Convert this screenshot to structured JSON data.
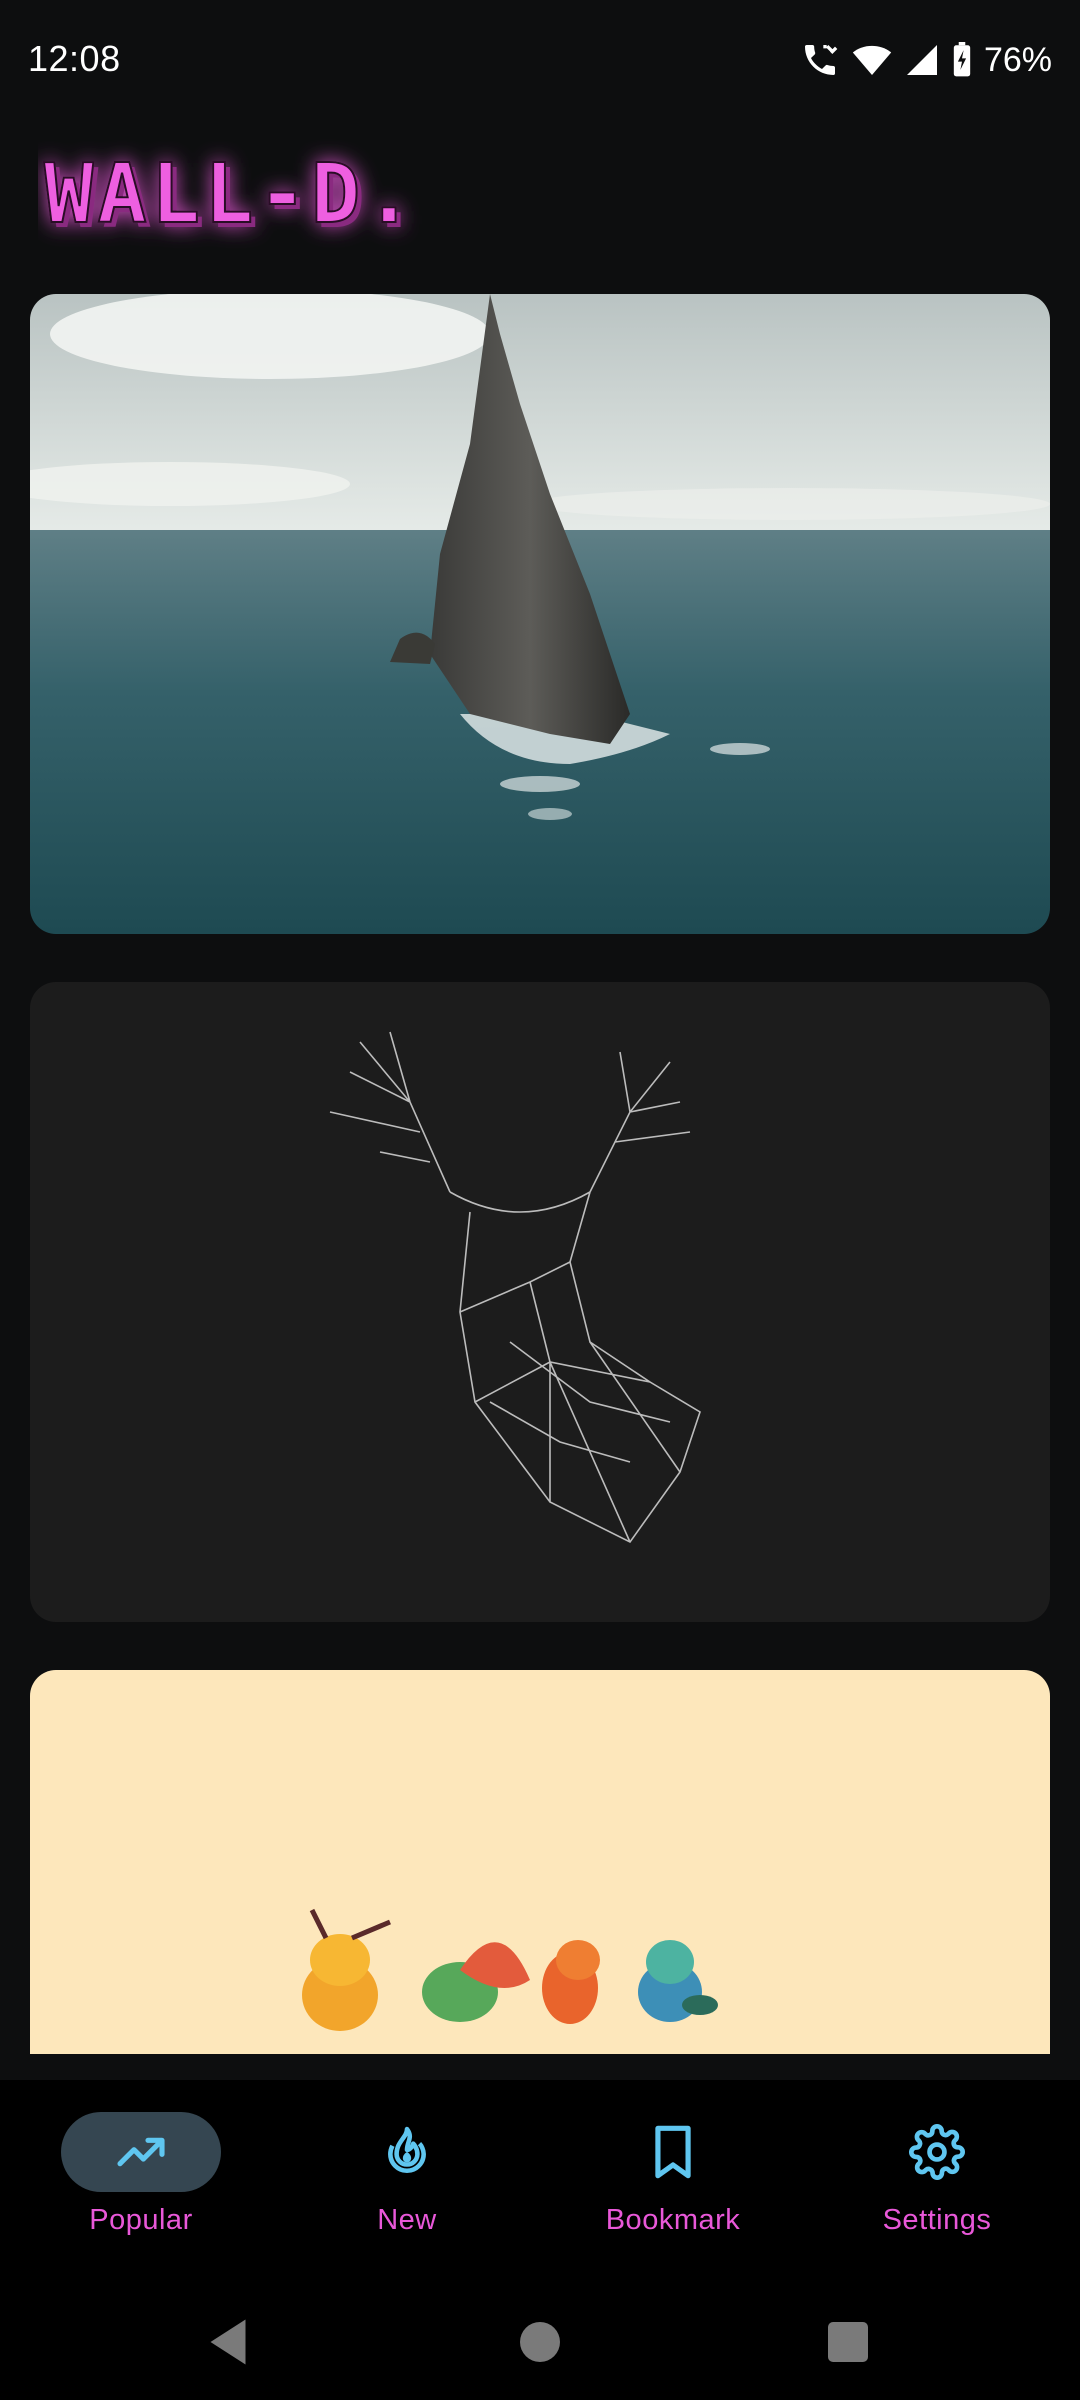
{
  "status_bar": {
    "time": "12:08",
    "battery": "76%"
  },
  "app": {
    "logo_text": "WALL-D.",
    "accent_color": "#e958d9",
    "icon_color": "#5fc6f0"
  },
  "wallpapers": [
    {
      "subject": "sea-stack-ocean"
    },
    {
      "subject": "wireframe-deer"
    },
    {
      "subject": "cute-creatures"
    }
  ],
  "bottom_nav": {
    "items": [
      {
        "label": "Popular",
        "icon": "trending-up-icon",
        "active": true
      },
      {
        "label": "New",
        "icon": "fire-icon",
        "active": false
      },
      {
        "label": "Bookmark",
        "icon": "bookmark-icon",
        "active": false
      },
      {
        "label": "Settings",
        "icon": "gear-icon",
        "active": false
      }
    ]
  }
}
